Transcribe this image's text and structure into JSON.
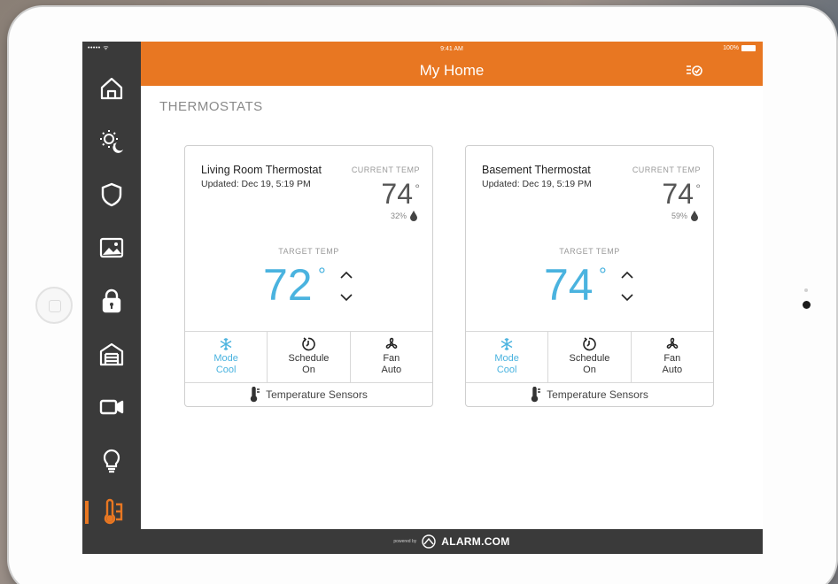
{
  "status": {
    "signal": "••••• ᯤ",
    "time": "9:41 AM",
    "battery": "100%"
  },
  "header": {
    "title": "My Home"
  },
  "sidebar": {
    "items": [
      {
        "icon": "home-icon"
      },
      {
        "icon": "day-night-icon"
      },
      {
        "icon": "shield-icon"
      },
      {
        "icon": "image-icon"
      },
      {
        "icon": "lock-icon"
      },
      {
        "icon": "garage-icon"
      },
      {
        "icon": "video-camera-icon"
      },
      {
        "icon": "lightbulb-icon"
      },
      {
        "icon": "thermostat-icon",
        "active": true
      }
    ]
  },
  "section": {
    "title": "THERMOSTATS"
  },
  "thermostats": [
    {
      "name": "Living Room Thermostat",
      "updated": "Updated: Dec 19, 5:19 PM",
      "current_label": "CURRENT TEMP",
      "current_temp": "74",
      "current_deg": "°",
      "humidity": "32%",
      "target_label": "TARGET TEMP",
      "target_temp": "72",
      "target_deg": "°",
      "mode_label": "Mode",
      "mode_value": "Cool",
      "schedule_label": "Schedule",
      "schedule_value": "On",
      "fan_label": "Fan",
      "fan_value": "Auto",
      "sensors": "Temperature Sensors"
    },
    {
      "name": "Basement Thermostat",
      "updated": "Updated: Dec 19, 5:19 PM",
      "current_label": "CURRENT TEMP",
      "current_temp": "74",
      "current_deg": "°",
      "humidity": "59%",
      "target_label": "TARGET TEMP",
      "target_temp": "74",
      "target_deg": "°",
      "mode_label": "Mode",
      "mode_value": "Cool",
      "schedule_label": "Schedule",
      "schedule_value": "On",
      "fan_label": "Fan",
      "fan_value": "Auto",
      "sensors": "Temperature Sensors"
    }
  ],
  "footer": {
    "powered_by": "powered by",
    "brand": "ALARM.COM"
  },
  "colors": {
    "accent": "#e87722",
    "target": "#4ab3df",
    "sidebar": "#3a3a3a"
  }
}
